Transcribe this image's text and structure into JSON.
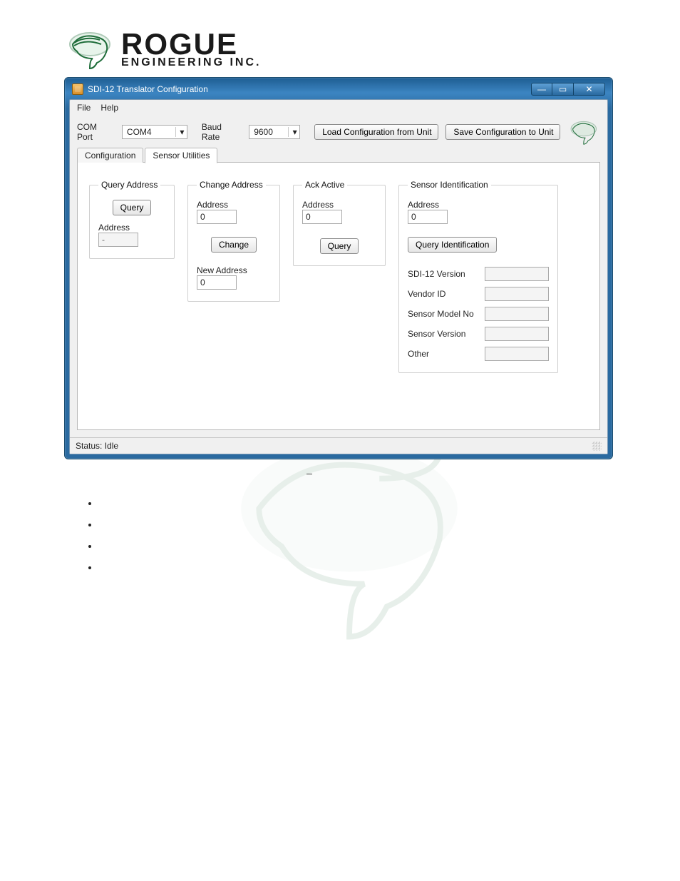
{
  "brand": {
    "main": "ROGUE",
    "sub": "ENGINEERING INC."
  },
  "window": {
    "title": "SDI-12 Translator Configuration",
    "minimize_symbol": "—",
    "maximize_symbol": "▭",
    "close_symbol": "✕"
  },
  "menu": {
    "file": "File",
    "help": "Help"
  },
  "toolbar": {
    "com_port_label": "COM Port",
    "com_port_value": "COM4",
    "baud_rate_label": "Baud Rate",
    "baud_rate_value": "9600",
    "load_button": "Load Configuration from Unit",
    "save_button": "Save Configuration to Unit"
  },
  "tabs": {
    "configuration": "Configuration",
    "sensor_utilities": "Sensor Utilities"
  },
  "groups": {
    "query_address": {
      "legend": "Query Address",
      "query_button": "Query",
      "address_label": "Address",
      "address_value": "-"
    },
    "change_address": {
      "legend": "Change Address",
      "address_label": "Address",
      "address_value": "0",
      "change_button": "Change",
      "new_address_label": "New Address",
      "new_address_value": "0"
    },
    "ack_active": {
      "legend": "Ack Active",
      "address_label": "Address",
      "address_value": "0",
      "query_button": "Query"
    },
    "sensor_identification": {
      "legend": "Sensor Identification",
      "address_label": "Address",
      "address_value": "0",
      "query_identification_button": "Query Identification",
      "sdi12_version_label": "SDI-12 Version",
      "sdi12_version_value": "",
      "vendor_id_label": "Vendor ID",
      "vendor_id_value": "",
      "sensor_model_label": "Sensor Model No",
      "sensor_model_value": "",
      "sensor_version_label": "Sensor Version",
      "sensor_version_value": "",
      "other_label": "Other",
      "other_value": ""
    }
  },
  "status": {
    "text": "Status: Idle"
  },
  "colors": {
    "window_frame": "#2a6aa0",
    "accent_green": "#1f6d3a"
  }
}
